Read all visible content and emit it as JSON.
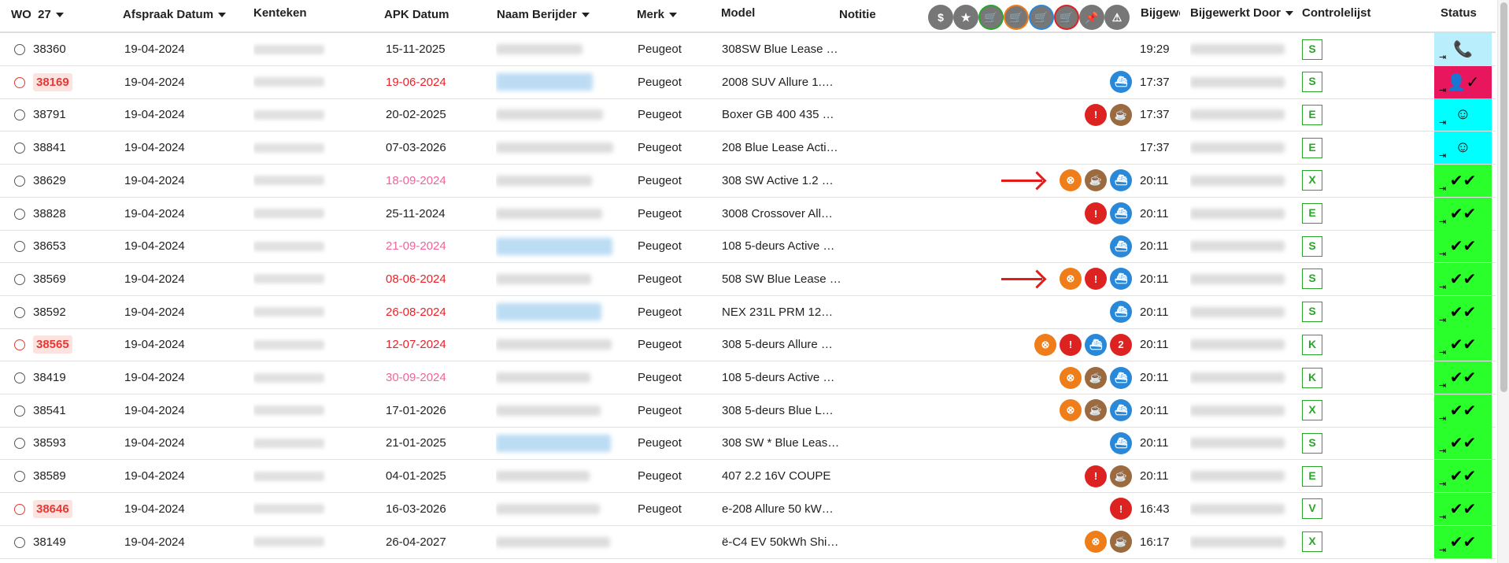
{
  "header": {
    "wo": "WO",
    "wo_count": "27",
    "date": "Afspraak Datum",
    "plate": "Kenteken",
    "apk": "APK Datum",
    "driver": "Naam Berijder",
    "brand": "Merk",
    "model": "Model",
    "note": "Notitie",
    "updated": "Bijgewe",
    "updated_by": "Bijgewerkt Door",
    "checklist": "Controlelijst",
    "status": "Status",
    "icons": [
      {
        "name": "dollar-icon",
        "glyph": "$",
        "ring": "#777"
      },
      {
        "name": "star-icon",
        "glyph": "★",
        "ring": "#777"
      },
      {
        "name": "cart-green-icon",
        "glyph": "🛒",
        "ring": "#2aa52a"
      },
      {
        "name": "cart-orange-icon",
        "glyph": "🛒",
        "ring": "#ef7d1a"
      },
      {
        "name": "cart-blue-icon",
        "glyph": "🛒",
        "ring": "#2a88d8"
      },
      {
        "name": "cart-red-icon",
        "glyph": "🛒",
        "ring": "#dd2222"
      },
      {
        "name": "pin-icon",
        "glyph": "📌",
        "ring": "#777"
      },
      {
        "name": "warning-icon",
        "glyph": "⚠",
        "ring": "#777"
      }
    ]
  },
  "colors": {
    "status_green": "#2bff2b",
    "status_cyan": "#00ffff",
    "status_light_blue": "#b9eefd",
    "status_pink": "#e8175d",
    "date_red": "#e8232a",
    "date_pink": "#f0649b"
  },
  "rows": [
    {
      "wo": "38360",
      "hl": false,
      "date": "19-04-2024",
      "apk": "15-11-2025",
      "apk_color": "",
      "driver_blue": false,
      "merk": "Peugeot",
      "model": "308SW Blue Lease …",
      "icons": [],
      "arrow": false,
      "time": "19:29",
      "chk": "S",
      "status": "phone",
      "status_bg": "#b9eefd"
    },
    {
      "wo": "38169",
      "hl": true,
      "date": "19-04-2024",
      "apk": "19-06-2024",
      "apk_color": "red",
      "driver_blue": true,
      "merk": "Peugeot",
      "model": "2008 SUV Allure 1.…",
      "icons": [
        "boat"
      ],
      "arrow": false,
      "time": "17:37",
      "chk": "S",
      "status": "user-check",
      "status_bg": "#e8175d"
    },
    {
      "wo": "38791",
      "hl": false,
      "date": "19-04-2024",
      "apk": "20-02-2025",
      "apk_color": "",
      "driver_blue": false,
      "merk": "Peugeot",
      "model": "Boxer GB 400 435 …",
      "icons": [
        "warn",
        "cup"
      ],
      "arrow": false,
      "time": "17:37",
      "chk": "E",
      "status": "face",
      "status_bg": "#00ffff"
    },
    {
      "wo": "38841",
      "hl": false,
      "date": "19-04-2024",
      "apk": "07-03-2026",
      "apk_color": "",
      "driver_blue": false,
      "merk": "Peugeot",
      "model": "208 Blue Lease Acti…",
      "icons": [],
      "arrow": false,
      "time": "17:37",
      "chk": "E",
      "status": "face",
      "status_bg": "#00ffff"
    },
    {
      "wo": "38629",
      "hl": false,
      "date": "19-04-2024",
      "apk": "18-09-2024",
      "apk_color": "pink",
      "driver_blue": false,
      "merk": "Peugeot",
      "model": "308 SW Active 1.2 …",
      "icons": [
        "wheel",
        "cup",
        "boat"
      ],
      "arrow": true,
      "time": "20:11",
      "chk": "X",
      "status": "check",
      "status_bg": "#2bff2b"
    },
    {
      "wo": "38828",
      "hl": false,
      "date": "19-04-2024",
      "apk": "25-11-2024",
      "apk_color": "",
      "driver_blue": false,
      "merk": "Peugeot",
      "model": "3008 Crossover All…",
      "icons": [
        "warn",
        "boat"
      ],
      "arrow": false,
      "time": "20:11",
      "chk": "E",
      "status": "check",
      "status_bg": "#2bff2b"
    },
    {
      "wo": "38653",
      "hl": false,
      "date": "19-04-2024",
      "apk": "21-09-2024",
      "apk_color": "pink",
      "driver_blue": true,
      "merk": "Peugeot",
      "model": "108 5-deurs Active …",
      "icons": [
        "boat"
      ],
      "arrow": false,
      "time": "20:11",
      "chk": "S",
      "status": "check",
      "status_bg": "#2bff2b"
    },
    {
      "wo": "38569",
      "hl": false,
      "date": "19-04-2024",
      "apk": "08-06-2024",
      "apk_color": "red",
      "driver_blue": false,
      "merk": "Peugeot",
      "model": "508 SW Blue Lease …",
      "icons": [
        "wheel",
        "warn",
        "boat"
      ],
      "arrow": true,
      "time": "20:11",
      "chk": "S",
      "status": "check",
      "status_bg": "#2bff2b"
    },
    {
      "wo": "38592",
      "hl": false,
      "date": "19-04-2024",
      "apk": "26-08-2024",
      "apk_color": "red",
      "driver_blue": true,
      "merk": "Peugeot",
      "model": "NEX 231L PRM 12…",
      "icons": [
        "boat"
      ],
      "arrow": false,
      "time": "20:11",
      "chk": "S",
      "status": "check",
      "status_bg": "#2bff2b"
    },
    {
      "wo": "38565",
      "hl": true,
      "date": "19-04-2024",
      "apk": "12-07-2024",
      "apk_color": "red",
      "driver_blue": false,
      "merk": "Peugeot",
      "model": "308 5-deurs Allure …",
      "icons": [
        "wheel",
        "warn",
        "boat",
        "num"
      ],
      "num": "2",
      "arrow": false,
      "time": "20:11",
      "chk": "K",
      "status": "check",
      "status_bg": "#2bff2b"
    },
    {
      "wo": "38419",
      "hl": false,
      "date": "19-04-2024",
      "apk": "30-09-2024",
      "apk_color": "pink",
      "driver_blue": false,
      "merk": "Peugeot",
      "model": "108 5-deurs Active …",
      "icons": [
        "wheel",
        "cup",
        "boat"
      ],
      "arrow": false,
      "time": "20:11",
      "chk": "K",
      "status": "check",
      "status_bg": "#2bff2b"
    },
    {
      "wo": "38541",
      "hl": false,
      "date": "19-04-2024",
      "apk": "17-01-2026",
      "apk_color": "",
      "driver_blue": false,
      "merk": "Peugeot",
      "model": "308 5-deurs Blue L…",
      "icons": [
        "wheel",
        "cup",
        "boat"
      ],
      "arrow": false,
      "time": "20:11",
      "chk": "X",
      "status": "check",
      "status_bg": "#2bff2b"
    },
    {
      "wo": "38593",
      "hl": false,
      "date": "19-04-2024",
      "apk": "21-01-2025",
      "apk_color": "",
      "driver_blue": true,
      "merk": "Peugeot",
      "model": "308 SW * Blue Leas…",
      "icons": [
        "boat"
      ],
      "arrow": false,
      "time": "20:11",
      "chk": "S",
      "status": "check",
      "status_bg": "#2bff2b"
    },
    {
      "wo": "38589",
      "hl": false,
      "date": "19-04-2024",
      "apk": "04-01-2025",
      "apk_color": "",
      "driver_blue": false,
      "merk": "Peugeot",
      "model": "407 2.2 16V COUPE",
      "icons": [
        "warn",
        "cup"
      ],
      "arrow": false,
      "time": "20:11",
      "chk": "E",
      "status": "check",
      "status_bg": "#2bff2b"
    },
    {
      "wo": "38646",
      "hl": true,
      "date": "19-04-2024",
      "apk": "16-03-2026",
      "apk_color": "",
      "driver_blue": false,
      "merk": "Peugeot",
      "model": "e-208 Allure 50 kW…",
      "icons": [
        "warn"
      ],
      "arrow": false,
      "time": "16:43",
      "chk": "V",
      "status": "check",
      "status_bg": "#2bff2b"
    },
    {
      "wo": "38149",
      "hl": false,
      "date": "19-04-2024",
      "apk": "26-04-2027",
      "apk_color": "",
      "driver_blue": false,
      "merk": "",
      "model": "ë-C4 EV 50kWh Shi…",
      "icons": [
        "wheel",
        "cup"
      ],
      "arrow": false,
      "time": "16:17",
      "chk": "X",
      "status": "check",
      "status_bg": "#2bff2b"
    }
  ]
}
